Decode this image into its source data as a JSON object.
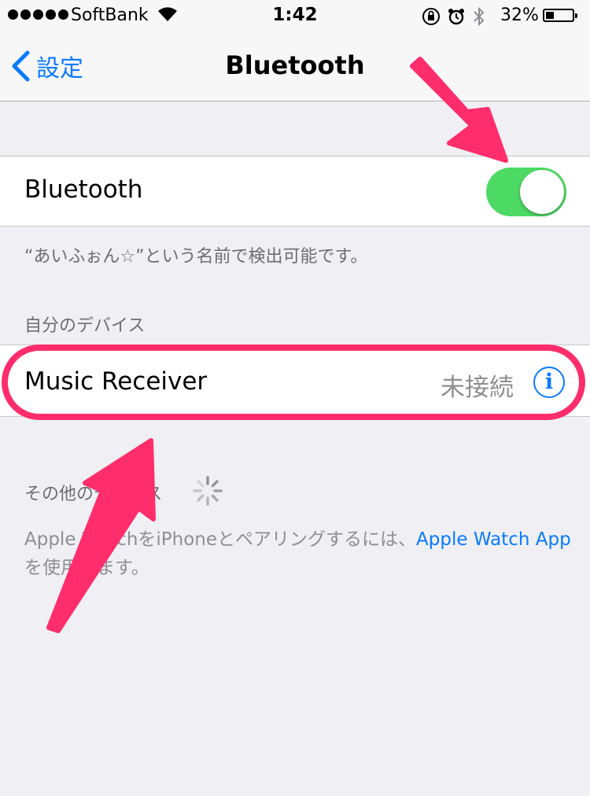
{
  "status_bar": {
    "carrier": "SoftBank",
    "time": "1:42",
    "battery_percent": "32%",
    "battery_level": 0.32
  },
  "nav": {
    "back_label": "設定",
    "title": "Bluetooth"
  },
  "bluetooth_row": {
    "label": "Bluetooth",
    "enabled": true
  },
  "discoverable_note": "“あいふぉん☆”という名前で検出可能です。",
  "my_devices": {
    "header": "自分のデバイス",
    "devices": [
      {
        "name": "Music Receiver",
        "status": "未接続"
      }
    ]
  },
  "other_devices": {
    "header": "その他のデバイス"
  },
  "watch_note": {
    "text_before": "Apple WatchをiPhoneとペアリングするには、",
    "link": "Apple Watch App",
    "text_after": "を使用します。"
  },
  "colors": {
    "accent": "#0a7aff",
    "toggle_on": "#4cd964",
    "annotation": "#ff2d6b",
    "background": "#efeff4"
  }
}
